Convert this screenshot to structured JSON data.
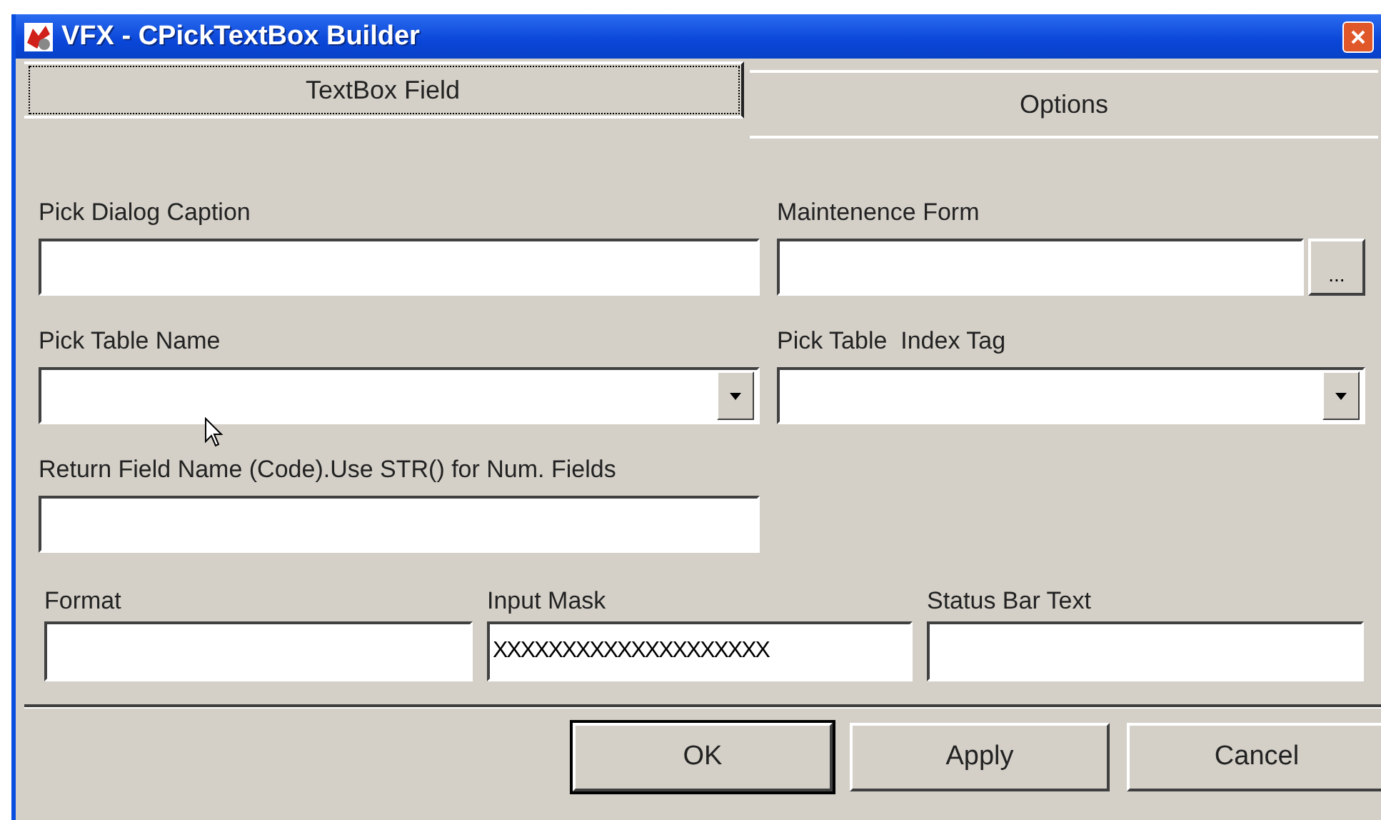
{
  "window": {
    "title": "VFX - CPickTextBox Builder"
  },
  "tabs": [
    {
      "label": "TextBox Field",
      "selected": true
    },
    {
      "label": "Options",
      "selected": false
    }
  ],
  "fields": [
    {
      "label": "Pick Dialog Caption",
      "kind": "text"
    },
    {
      "label": "Maintenence Form",
      "kind": "browse",
      "button": "..."
    },
    {
      "label": "Pick Table Name",
      "kind": "combo"
    },
    {
      "label": "Pick Table  Index Tag",
      "kind": "combo"
    },
    {
      "label": "Return Field Name (Code).Use STR() for Num. Fields",
      "kind": "text"
    }
  ],
  "bottom_fields": [
    {
      "label": "Format"
    },
    {
      "label": "Input Mask",
      "value": "XXXXXXXXXXXXXXXXXXXX"
    },
    {
      "label": "Status Bar Text"
    }
  ],
  "buttons": [
    {
      "label": "OK",
      "default": true
    },
    {
      "label": "Apply",
      "default": false
    },
    {
      "label": "Cancel",
      "default": false
    }
  ]
}
